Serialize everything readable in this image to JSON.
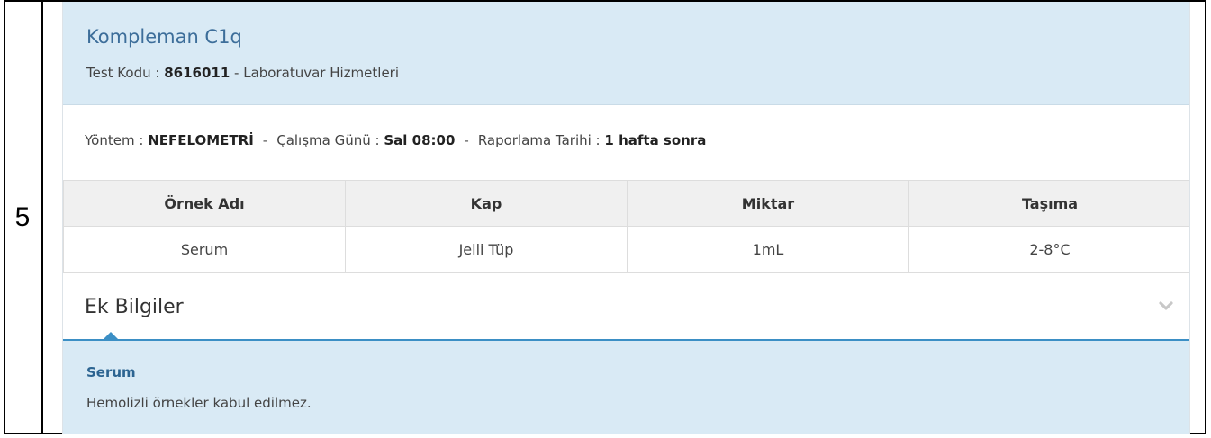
{
  "row_number": "5",
  "test": {
    "name": "Kompleman C1q",
    "code_label": "Test Kodu :",
    "code_value": "8616011",
    "code_sep": " - ",
    "department": "Laboratuvar Hizmetleri"
  },
  "info": {
    "method_label": "Yöntem :",
    "method_value": "NEFELOMETRİ",
    "day_label": "Çalışma Günü :",
    "day_value": "Sal 08:00",
    "report_label": "Raporlama Tarihi :",
    "report_value": "1 hafta sonra",
    "separator": "-"
  },
  "table": {
    "headers": [
      "Örnek Adı",
      "Kap",
      "Miktar",
      "Taşıma"
    ],
    "rows": [
      [
        "Serum",
        "Jelli Tüp",
        "1mL",
        "2-8°C"
      ]
    ]
  },
  "extra": {
    "title": "Ek Bilgiler",
    "toggle_icon": "chevron-down-icon",
    "section_title": "Serum",
    "section_text": "Hemolizli örnekler kabul edilmez."
  },
  "colors": {
    "header_bg": "#d9eaf5",
    "title_blue": "#3d6e9a",
    "accent_line": "#3b8fc5"
  }
}
